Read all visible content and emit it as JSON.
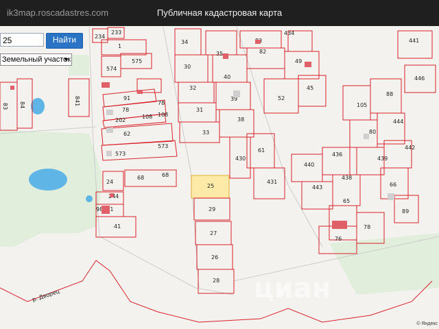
{
  "window": {
    "url": "ik3map.roscadastres.com",
    "title": "Публичная кадастровая карта"
  },
  "search": {
    "value": "25",
    "button": "Найти"
  },
  "layer_select": {
    "value": "Земельный участок"
  },
  "attribution": "© Яндекс",
  "watermark": "циан",
  "river_label": "р. Дворец",
  "colors": {
    "parcel_stroke": "#d8202a",
    "highlight_fill": "#fde9a8",
    "water": "#63b7e6",
    "greenery": "#dfeeda"
  },
  "parcels": [
    "234",
    "233",
    "1",
    "574",
    "575",
    "91",
    "78",
    "78",
    "202",
    "108",
    "108",
    "62",
    "573",
    "573",
    "24",
    "68",
    "68",
    "244",
    "98071",
    "41",
    "63",
    "62",
    "76",
    "79",
    "83",
    "34",
    "35",
    "30",
    "32",
    "40",
    "31",
    "39",
    "33",
    "38",
    "434",
    "83",
    "82",
    "49",
    "52",
    "45",
    "61",
    "430",
    "431",
    "25",
    "29",
    "27",
    "26",
    "28",
    "105",
    "88",
    "80",
    "444",
    "439",
    "442",
    "440",
    "436",
    "443",
    "65",
    "66",
    "89",
    "78",
    "76",
    "441",
    "446",
    "841",
    "83",
    "84"
  ]
}
